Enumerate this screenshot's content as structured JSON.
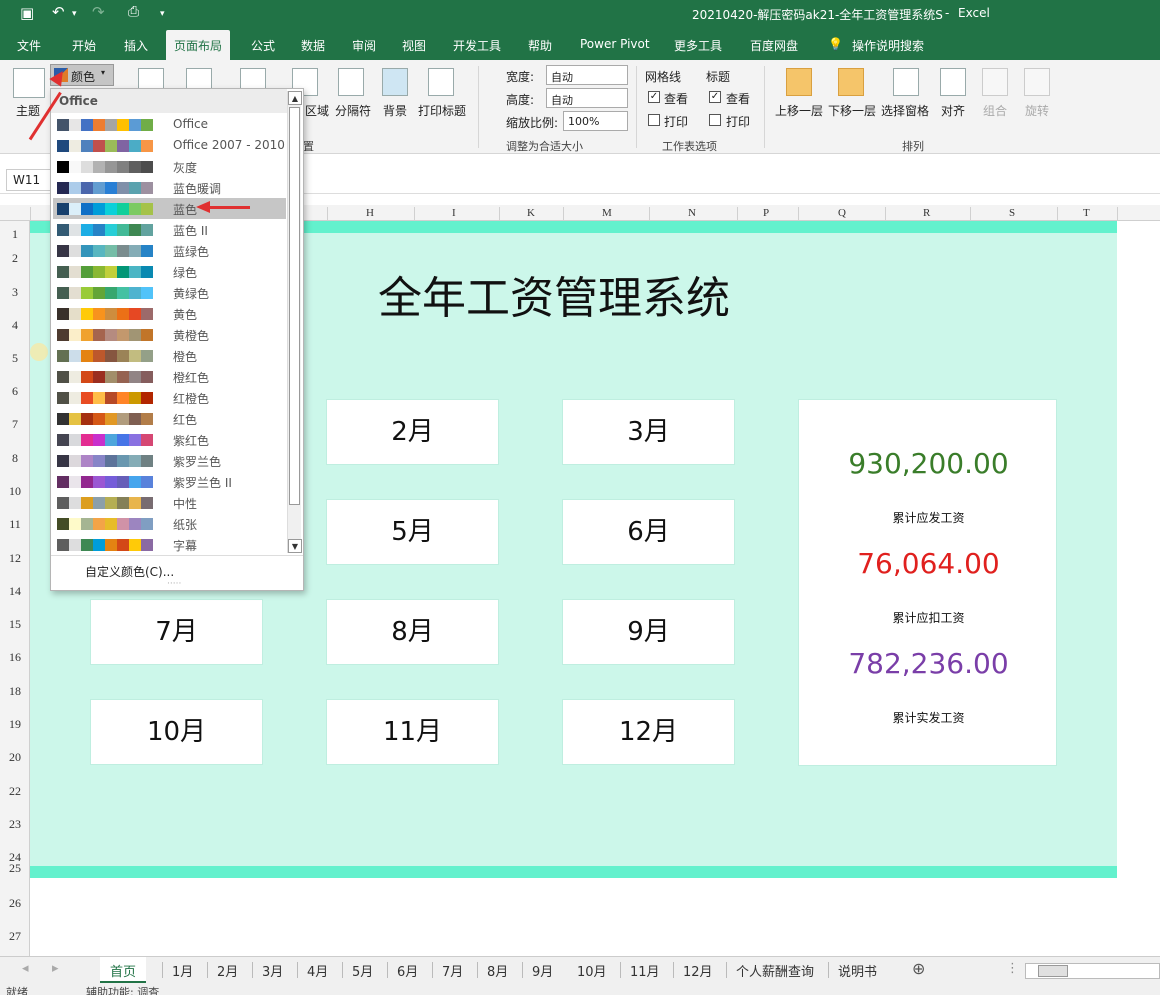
{
  "titlebar": {
    "filename": "20210420-解压密码ak21-全年工资管理系统S",
    "sep": "-",
    "app": "Excel"
  },
  "ribbon_tabs": [
    "文件",
    "开始",
    "插入",
    "页面布局",
    "公式",
    "数据",
    "审阅",
    "视图",
    "开发工具",
    "帮助",
    "Power Pivot",
    "更多工具",
    "百度网盘",
    "操作说明搜索"
  ],
  "ribbon": {
    "theme_label": "主题",
    "colors_label": "颜色",
    "print_area_label": "区域",
    "breaks_label": "分隔符",
    "background_label": "背景",
    "print_titles_label": "打印标题",
    "page_setup_group_suffix": "置",
    "width_label": "宽度:",
    "width_value": "自动",
    "height_label": "高度:",
    "height_value": "自动",
    "scale_label": "缩放比例:",
    "scale_value": "100%",
    "scale_group": "调整为合适大小",
    "gridlines_label": "网格线",
    "headings_label": "标题",
    "view_label": "查看",
    "print_label": "打印",
    "sheet_options_group": "工作表选项",
    "bring_forward": "上移一层",
    "send_backward": "下移一层",
    "selection_pane": "选择窗格",
    "align": "对齐",
    "group": "组合",
    "rotate": "旋转",
    "arrange_group": "排列"
  },
  "namebox": "W11",
  "columns": [
    "H",
    "I",
    "K",
    "M",
    "N",
    "P",
    "Q",
    "R",
    "S",
    "T"
  ],
  "rows": [
    "1",
    "2",
    "3",
    "4",
    "5",
    "6",
    "7",
    "8",
    "10",
    "11",
    "12",
    "14",
    "15",
    "16",
    "18",
    "19",
    "20",
    "22",
    "23",
    "24",
    "25",
    "26",
    "27"
  ],
  "sheet": {
    "title": "全年工资管理系统",
    "months": [
      "2月",
      "3月",
      "5月",
      "6月",
      "7月",
      "8月",
      "9月",
      "10月",
      "11月",
      "12月"
    ],
    "total_payable": "930,200.00",
    "total_payable_label": "累计应发工资",
    "total_deduction": "76,064.00",
    "total_deduction_label": "累计应扣工资",
    "total_actual": "782,236.00",
    "total_actual_label": "累计实发工资",
    "colors": {
      "payable": "#3a7d2a",
      "deduction": "#e0201e",
      "actual": "#7a3ea8",
      "bg": "#ccf7ea",
      "band": "#63f1cd"
    }
  },
  "dropdown": {
    "header": "Office",
    "custom": "自定义颜色(C)...",
    "items": [
      {
        "label": "Office",
        "colors": [
          "#44546a",
          "#e7e6e6",
          "#4472c4",
          "#ed7d31",
          "#a5a5a5",
          "#ffc000",
          "#5b9bd5",
          "#70ad47"
        ]
      },
      {
        "label": "Office 2007 - 2010",
        "colors": [
          "#1f497d",
          "#eeece1",
          "#4f81bd",
          "#c0504d",
          "#9bbb59",
          "#8064a2",
          "#4bacc6",
          "#f79646"
        ]
      },
      {
        "label": "灰度",
        "colors": [
          "#000000",
          "#f8f8f8",
          "#dddddd",
          "#b2b2b2",
          "#969696",
          "#808080",
          "#5f5f5f",
          "#4d4d4d"
        ]
      },
      {
        "label": "蓝色暖调",
        "colors": [
          "#242852",
          "#acccea",
          "#4a66ac",
          "#629dd1",
          "#297fd5",
          "#7f8fa9",
          "#5aa2ae",
          "#9d90a0"
        ]
      },
      {
        "label": "蓝色",
        "colors": [
          "#17406d",
          "#dbeff9",
          "#0f6fc6",
          "#009dd9",
          "#0bd0d9",
          "#10cf9b",
          "#7cca62",
          "#a5c249"
        ]
      },
      {
        "label": "蓝色 II",
        "colors": [
          "#335b74",
          "#dfe3e5",
          "#1cade4",
          "#2683c6",
          "#27ced7",
          "#42ba97",
          "#3e8853",
          "#62a39f"
        ]
      },
      {
        "label": "蓝绿色",
        "colors": [
          "#373545",
          "#dedede",
          "#3494ba",
          "#58b6c0",
          "#75bda7",
          "#7a8c8e",
          "#84acb6",
          "#2683c6"
        ]
      },
      {
        "label": "绿色",
        "colors": [
          "#455f51",
          "#e3ded1",
          "#549e39",
          "#8ab833",
          "#c0cf3a",
          "#029676",
          "#4ab5c4",
          "#0989b1"
        ]
      },
      {
        "label": "黄绿色",
        "colors": [
          "#455f51",
          "#e3ded1",
          "#99cb38",
          "#63a537",
          "#37a76f",
          "#44c1a3",
          "#4eb3cf",
          "#51c3f9"
        ]
      },
      {
        "label": "黄色",
        "colors": [
          "#39302a",
          "#e5dec9",
          "#ffca08",
          "#f8931d",
          "#ce8d3e",
          "#ec7016",
          "#e64823",
          "#9c6a6a"
        ]
      },
      {
        "label": "黄橙色",
        "colors": [
          "#4e3b30",
          "#fbeec9",
          "#f0a22e",
          "#a5644e",
          "#b58b80",
          "#c3986d",
          "#a19574",
          "#c17529"
        ]
      },
      {
        "label": "橙色",
        "colors": [
          "#637052",
          "#ccddea",
          "#e48312",
          "#bd582c",
          "#865640",
          "#9b8357",
          "#c2bc80",
          "#94a088"
        ]
      },
      {
        "label": "橙红色",
        "colors": [
          "#505046",
          "#eeece1",
          "#d34817",
          "#9b2d1f",
          "#a28e6a",
          "#956251",
          "#918485",
          "#855d5d"
        ]
      },
      {
        "label": "红橙色",
        "colors": [
          "#505046",
          "#eeece1",
          "#e84c22",
          "#ffbd47",
          "#b64926",
          "#ff8427",
          "#cc9900",
          "#b22600"
        ]
      },
      {
        "label": "红色",
        "colors": [
          "#323232",
          "#e5c243",
          "#a5300f",
          "#d55816",
          "#e19825",
          "#b19c7d",
          "#7f5f52",
          "#b27d49"
        ]
      },
      {
        "label": "紫红色",
        "colors": [
          "#454551",
          "#d8d9dc",
          "#e32d91",
          "#c830cc",
          "#4ea6dc",
          "#4775e7",
          "#8971e1",
          "#d54773"
        ]
      },
      {
        "label": "紫罗兰色",
        "colors": [
          "#373545",
          "#dcd8dc",
          "#ad84c6",
          "#8784c7",
          "#5d739a",
          "#6997af",
          "#84acb6",
          "#6f8183"
        ]
      },
      {
        "label": "紫罗兰色 II",
        "colors": [
          "#632e62",
          "#eae5eb",
          "#92278f",
          "#9b57d3",
          "#755dd9",
          "#665eb8",
          "#45a5ed",
          "#5982db"
        ]
      },
      {
        "label": "中性",
        "colors": [
          "#5e5e5e",
          "#ddddde",
          "#dc9e1f",
          "#8b9faa",
          "#b5ae53",
          "#848058",
          "#e8b54d",
          "#786c71"
        ]
      },
      {
        "label": "纸张",
        "colors": [
          "#444d26",
          "#fefac9",
          "#a5b592",
          "#f3a447",
          "#e7bc29",
          "#d092a7",
          "#9c85c0",
          "#809ec2"
        ]
      },
      {
        "label": "字幕",
        "colors": [
          "#5e5e5e",
          "#ddddde",
          "#3e8853",
          "#009dd9",
          "#e48312",
          "#d34817",
          "#ffca08",
          "#8a6aa3"
        ]
      }
    ]
  },
  "sheet_tabs": [
    "首页",
    "1月",
    "2月",
    "3月",
    "4月",
    "5月",
    "6月",
    "7月",
    "8月",
    "9月",
    "5月",
    "10月",
    "11月",
    "12月",
    "个人薪酬查询",
    "说明书"
  ],
  "status": {
    "ready": "就绪",
    "accessibility": "辅助功能: 调查"
  }
}
